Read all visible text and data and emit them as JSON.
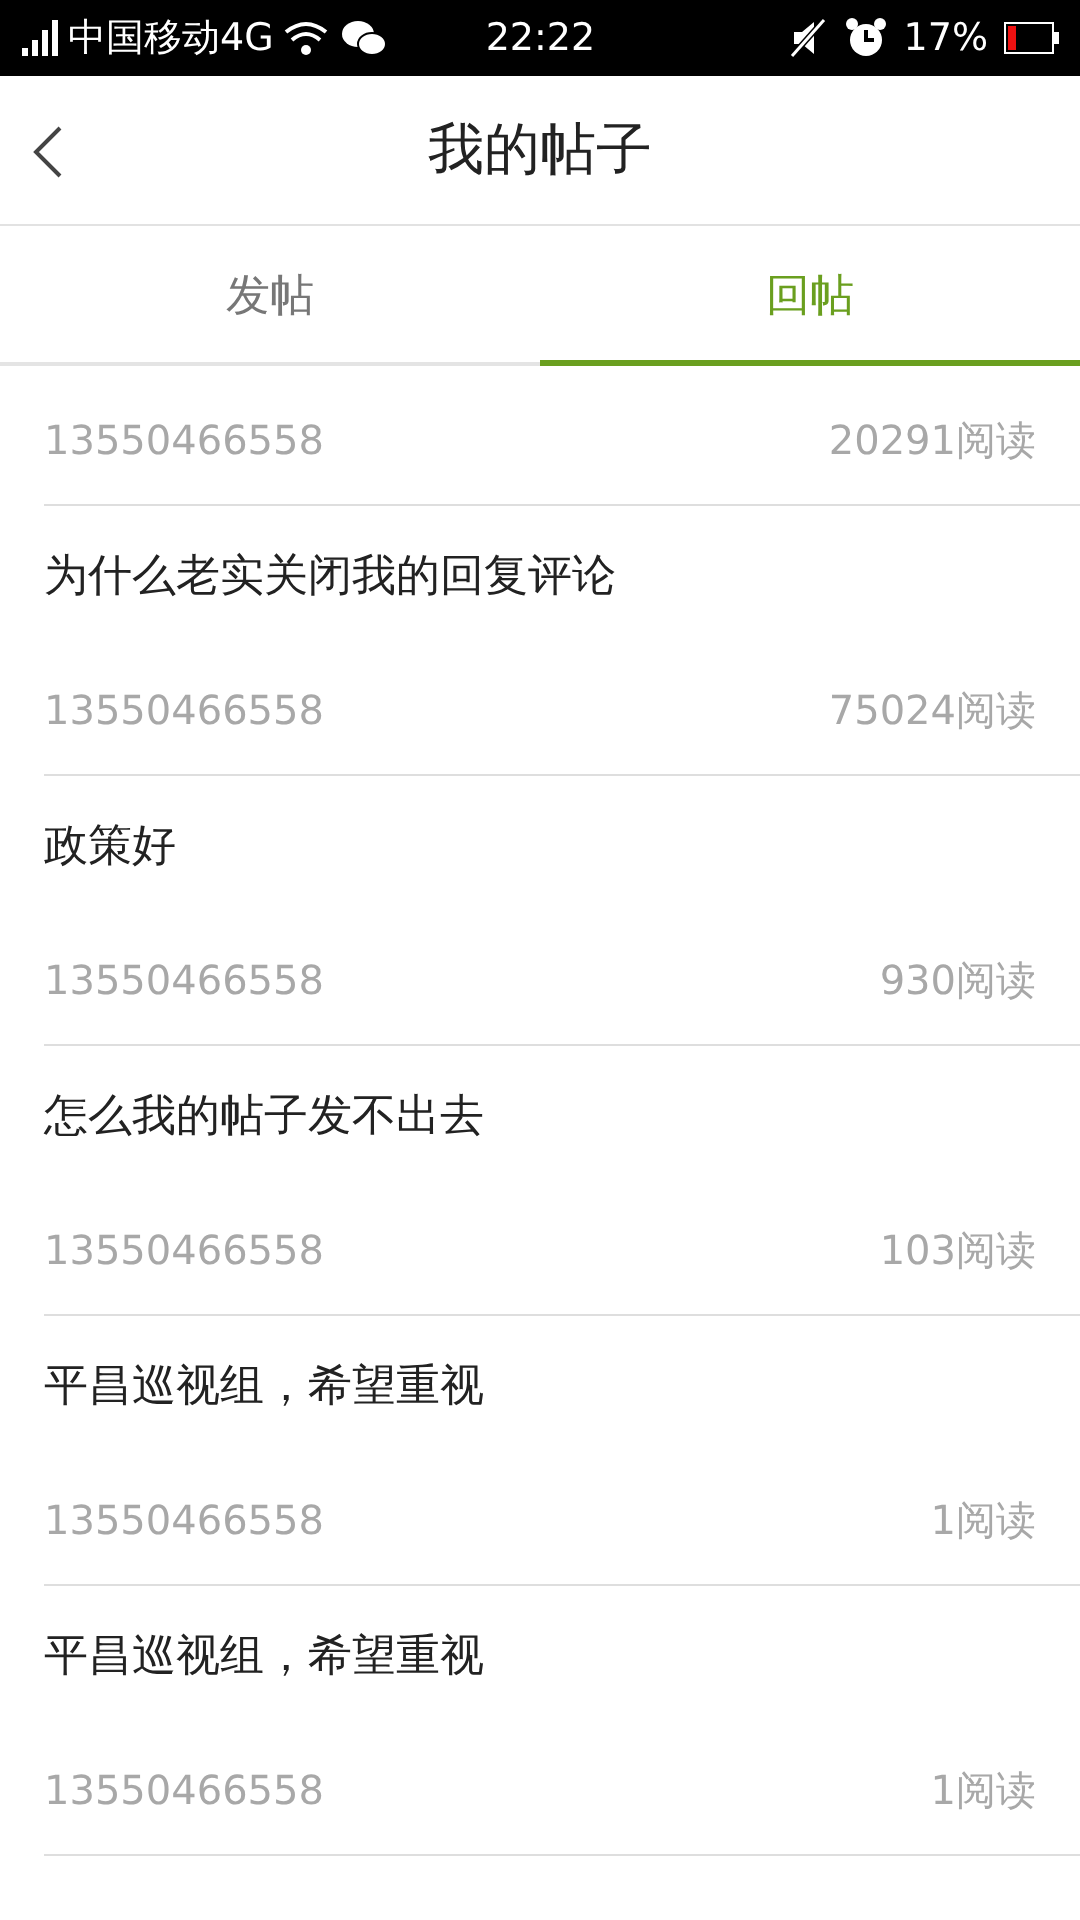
{
  "status_bar": {
    "carrier": "中国移动4G",
    "time": "22:22",
    "battery": "17%"
  },
  "header": {
    "title": "我的帖子"
  },
  "tabs": [
    {
      "label": "发帖",
      "selected": false
    },
    {
      "label": "回帖",
      "selected": true
    }
  ],
  "posts": [
    {
      "author": "13550466558",
      "reads": "20291阅读"
    },
    {
      "title": "为什么老实关闭我的回复评论",
      "author": "13550466558",
      "reads": "75024阅读"
    },
    {
      "title": "政策好",
      "author": "13550466558",
      "reads": "930阅读"
    },
    {
      "title": "怎么我的帖子发不出去",
      "author": "13550466558",
      "reads": "103阅读"
    },
    {
      "title": "平昌巡视组，希望重视",
      "author": "13550466558",
      "reads": "1阅读"
    },
    {
      "title": "平昌巡视组，希望重视",
      "author": "13550466558",
      "reads": "1阅读"
    }
  ]
}
